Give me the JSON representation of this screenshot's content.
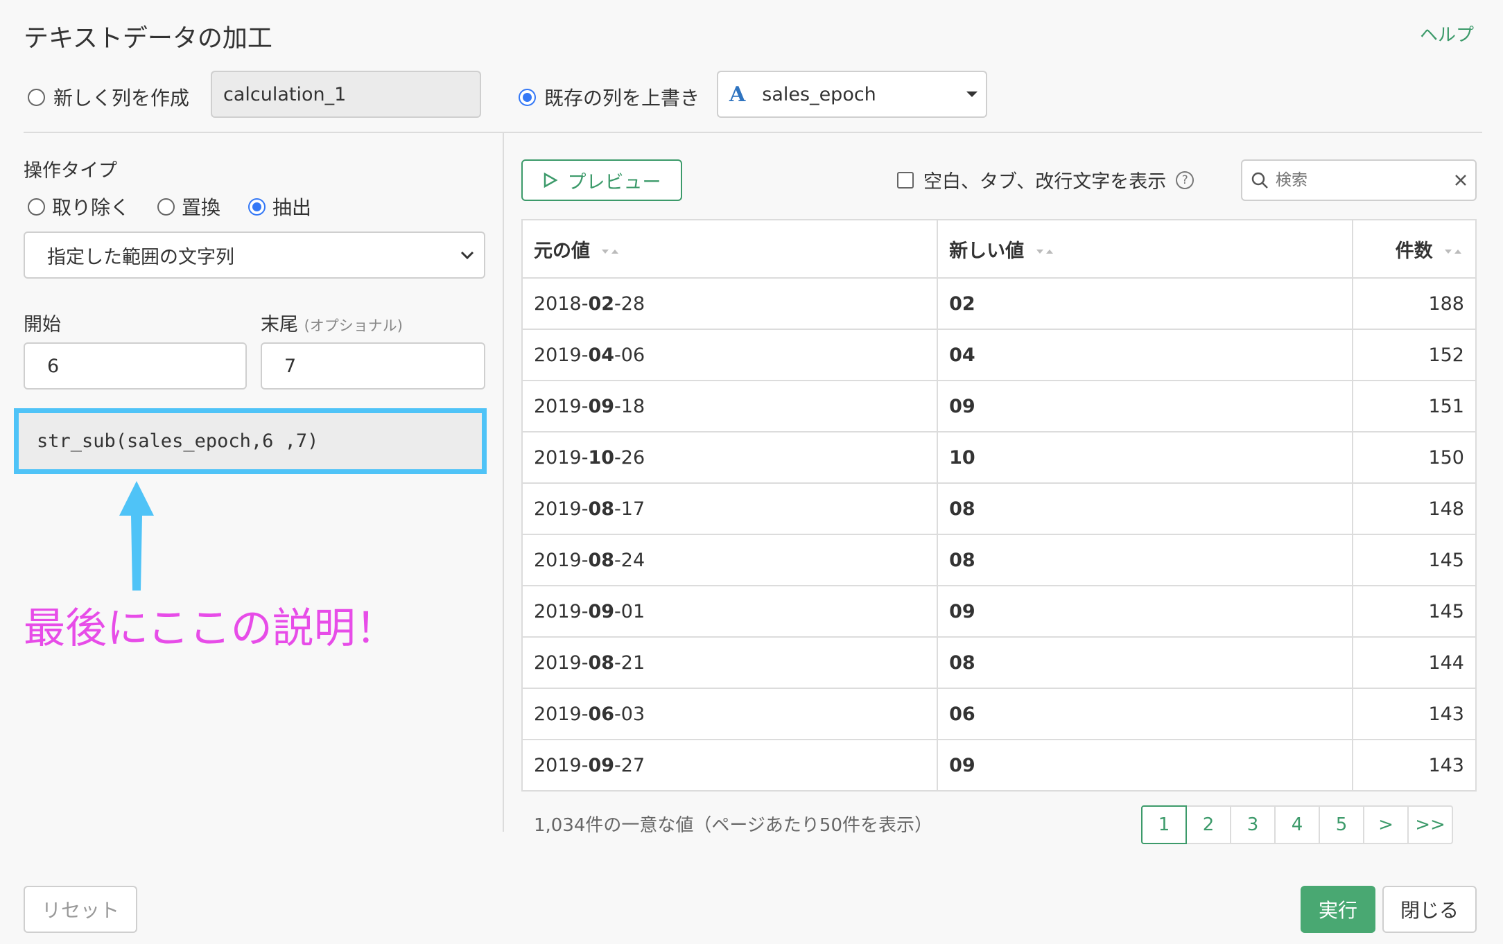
{
  "dialog": {
    "title": "テキストデータの加工",
    "help": "ヘルプ"
  },
  "column_mode": {
    "new_label": "新しく列を作成",
    "new_value": "calculation_1",
    "overwrite_label": "既存の列を上書き",
    "column_type_icon": "A",
    "column_name": "sales_epoch"
  },
  "operation": {
    "heading": "操作タイプ",
    "options": [
      "取り除く",
      "置換",
      "抽出"
    ],
    "selected": "抽出",
    "mode": "指定した範囲の文字列"
  },
  "range": {
    "start_label": "開始",
    "start_value": "6",
    "end_label": "末尾",
    "end_optional": "(オプショナル)",
    "end_value": "7"
  },
  "expression": "str_sub(sales_epoch,6 ,7)",
  "annotation": "最後にここの説明！",
  "preview": {
    "button_label": "プレビュー",
    "whitespace_label": "空白、タブ、改行文字を表示",
    "help_glyph": "?",
    "search_placeholder": "検索",
    "columns": [
      "元の値",
      "新しい値",
      "件数"
    ],
    "rows": [
      {
        "pre": "2018-",
        "mid": "02",
        "post": "-28",
        "new": "02",
        "count": "188"
      },
      {
        "pre": "2019-",
        "mid": "04",
        "post": "-06",
        "new": "04",
        "count": "152"
      },
      {
        "pre": "2019-",
        "mid": "09",
        "post": "-18",
        "new": "09",
        "count": "151"
      },
      {
        "pre": "2019-",
        "mid": "10",
        "post": "-26",
        "new": "10",
        "count": "150"
      },
      {
        "pre": "2019-",
        "mid": "08",
        "post": "-17",
        "new": "08",
        "count": "148"
      },
      {
        "pre": "2019-",
        "mid": "08",
        "post": "-24",
        "new": "08",
        "count": "145"
      },
      {
        "pre": "2019-",
        "mid": "09",
        "post": "-01",
        "new": "09",
        "count": "145"
      },
      {
        "pre": "2019-",
        "mid": "08",
        "post": "-21",
        "new": "08",
        "count": "144"
      },
      {
        "pre": "2019-",
        "mid": "06",
        "post": "-03",
        "new": "06",
        "count": "143"
      },
      {
        "pre": "2019-",
        "mid": "09",
        "post": "-27",
        "new": "09",
        "count": "143"
      }
    ],
    "summary": "1,034件の一意な値（ページあたり50件を表示）",
    "pages": [
      "1",
      "2",
      "3",
      "4",
      "5",
      ">",
      ">>"
    ],
    "active_page": "1"
  },
  "buttons": {
    "reset": "リセット",
    "run": "実行",
    "close": "閉じる"
  },
  "colors": {
    "accent": "#3c9a6a",
    "run": "#49a872",
    "highlight": "#4fc3f7",
    "annotation": "#e74ce8",
    "radio": "#3478f6"
  }
}
